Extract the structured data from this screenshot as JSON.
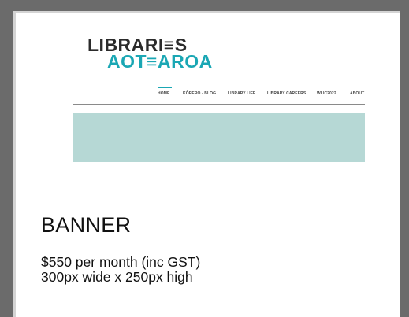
{
  "logo": {
    "line1": "LIBRARI≡S",
    "line2": "AOT≡AROA"
  },
  "nav": {
    "items": [
      {
        "label": "HOME",
        "active": true
      },
      {
        "label": "KŌRERO - BLOG"
      },
      {
        "label": "LIBRARY LIFE"
      },
      {
        "label": "LIBRARY CAREERS"
      },
      {
        "label": "WLIC2022"
      },
      {
        "label": "ABOUT"
      }
    ]
  },
  "banner": {
    "color": "#b6d8d5"
  },
  "accent_color": "#1aa7b4",
  "ad": {
    "title": "BANNER",
    "price": "$550 per month (inc GST)",
    "size": "300px wide x 250px high"
  }
}
